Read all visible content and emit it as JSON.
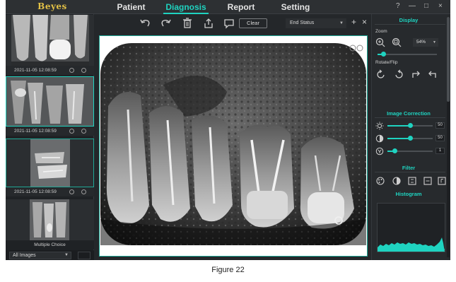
{
  "app": {
    "logo": "Beyes"
  },
  "nav": {
    "tabs": [
      {
        "label": "Patient",
        "active": false
      },
      {
        "label": "Diagnosis",
        "active": true
      },
      {
        "label": "Report",
        "active": false
      },
      {
        "label": "Setting",
        "active": false
      }
    ],
    "window_buttons": [
      "?",
      "—",
      "□",
      "×"
    ]
  },
  "thumbnails": [
    {
      "timestamp": "2021-11-05 12:08:59",
      "selected": false
    },
    {
      "timestamp": "2021-11-05 12:08:59",
      "selected": true
    },
    {
      "timestamp": "2021-11-05 12:08:59",
      "selected": false
    },
    {
      "caption": "Multiple Choice",
      "selected": false
    }
  ],
  "left_footer": {
    "filter_value": "All Images"
  },
  "toolbar": {
    "icons": [
      "undo-icon",
      "redo-icon",
      "delete-icon",
      "share-icon",
      "comment-icon"
    ],
    "clear_label": "Clear",
    "status_value": "End Status",
    "plus": "+",
    "close": "×"
  },
  "right_panel": {
    "display_title": "Display",
    "zoom_label": "Zoom",
    "zoom_value": "54%",
    "rotate_label": "Rotate/Flip",
    "image_correction_title": "Image Correction",
    "brightness_value": "50",
    "contrast_value": "50",
    "gamma_value": "1",
    "filter_title": "Filter",
    "histogram_title": "Histogram"
  },
  "figure_caption": "Figure 22",
  "colors": {
    "accent": "#1fd3c0",
    "logo": "#e2c046",
    "background": "#24272a"
  }
}
